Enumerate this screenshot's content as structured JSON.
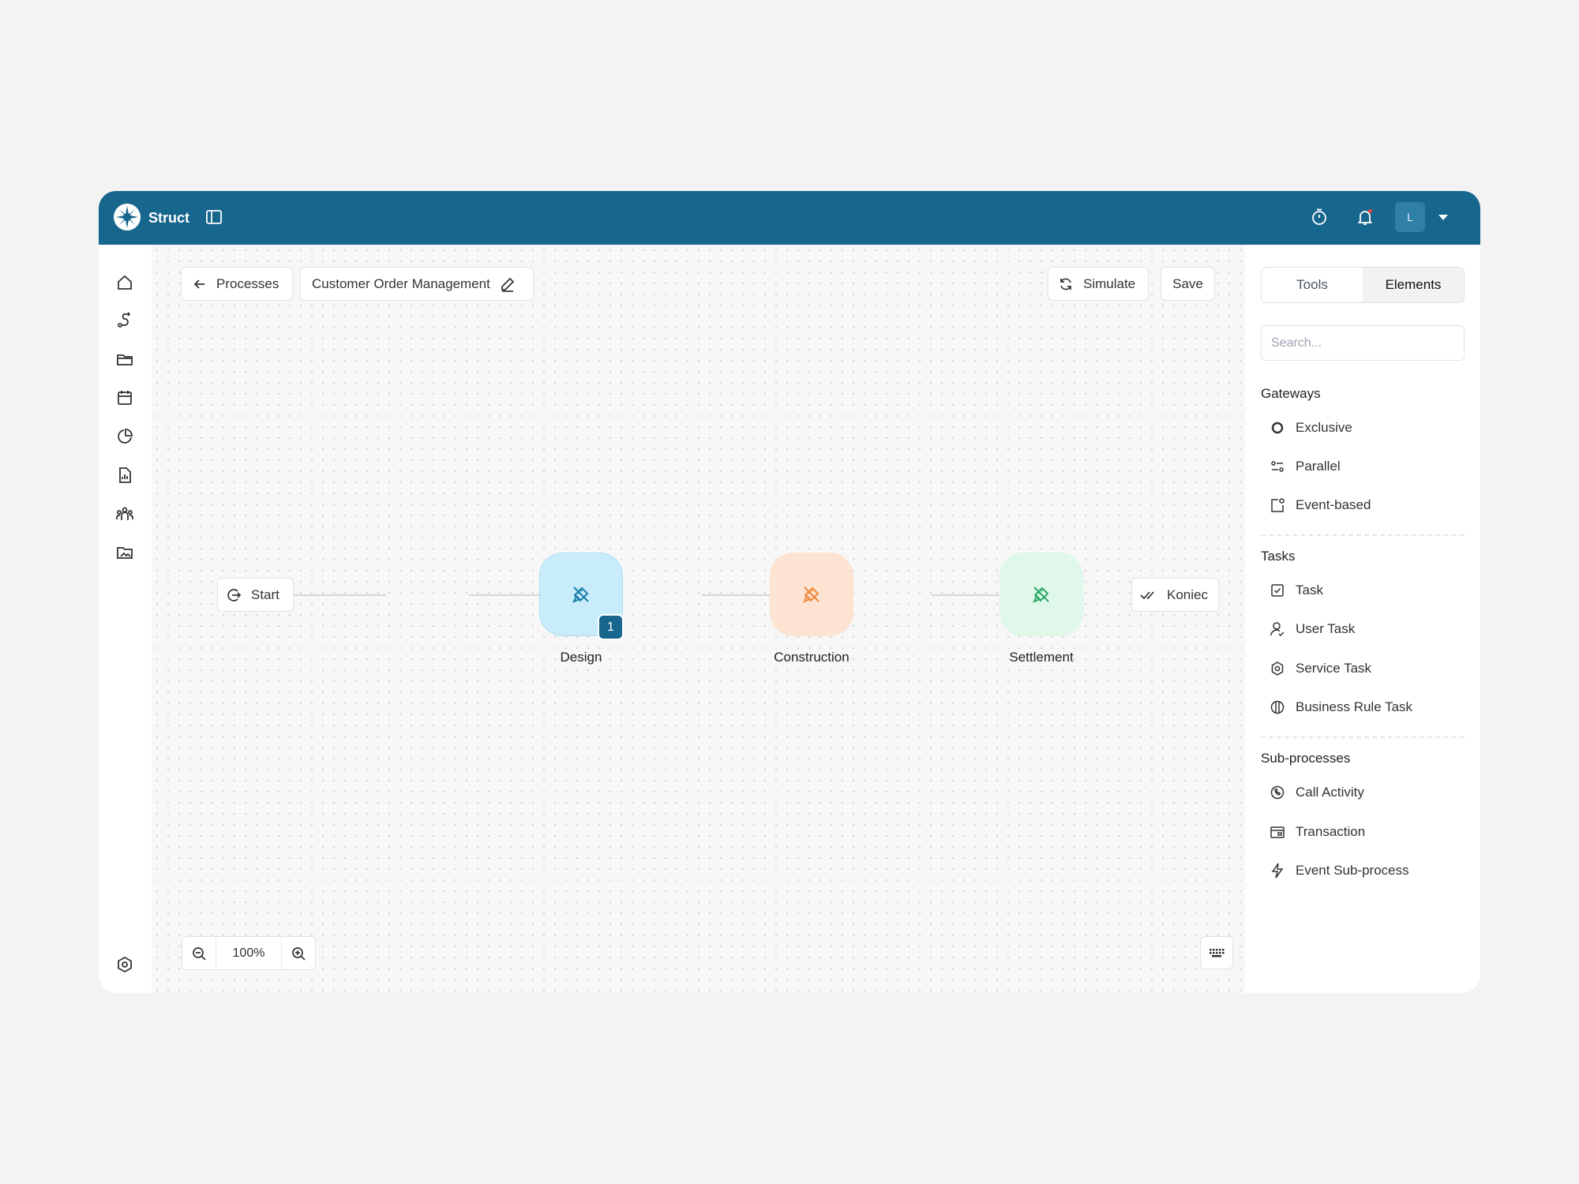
{
  "app": {
    "brand": "Struct",
    "avatar_initial": "L"
  },
  "topbar": {
    "icons": [
      "panel-toggle-icon",
      "timer-icon",
      "bell-icon",
      "caret-down-icon"
    ]
  },
  "sidenav": {
    "items": [
      "home-icon",
      "route-icon",
      "folder-icon",
      "calendar-icon",
      "pie-chart-icon",
      "report-icon",
      "team-icon",
      "image-folder-icon"
    ],
    "bottom": "settings-icon"
  },
  "toolbar": {
    "back_label": "Processes",
    "process_name": "Customer Order Management",
    "simulate_label": "Simulate",
    "save_label": "Save"
  },
  "flow": {
    "start_label": "Start",
    "end_label": "Koniec",
    "nodes": [
      {
        "label": "Design",
        "color": "#c9ecfb",
        "accent": "#1a7fa8",
        "badge": "1"
      },
      {
        "label": "Construction",
        "color": "#fde3d1",
        "accent": "#f08a3c"
      },
      {
        "label": "Settlement",
        "color": "#dff8ea",
        "accent": "#2ea86a"
      }
    ]
  },
  "zoom": {
    "value": "100%"
  },
  "panel": {
    "tabs": [
      "Tools",
      "Elements"
    ],
    "active_tab": "Elements",
    "search_placeholder": "Search...",
    "sections": [
      {
        "title": "Gateways",
        "items": [
          {
            "label": "Exclusive",
            "icon": "circle-icon"
          },
          {
            "label": "Parallel",
            "icon": "parallel-icon"
          },
          {
            "label": "Event-based",
            "icon": "event-based-icon"
          }
        ]
      },
      {
        "title": "Tasks",
        "items": [
          {
            "label": "Task",
            "icon": "checkbox-icon"
          },
          {
            "label": "User Task",
            "icon": "user-icon"
          },
          {
            "label": "Service Task",
            "icon": "gear-icon"
          },
          {
            "label": "Business Rule Task",
            "icon": "rule-icon"
          }
        ]
      },
      {
        "title": "Sub-processes",
        "items": [
          {
            "label": "Call Activity",
            "icon": "call-icon"
          },
          {
            "label": "Transaction",
            "icon": "transaction-icon"
          },
          {
            "label": "Event Sub-process",
            "icon": "lightning-icon"
          }
        ]
      }
    ]
  }
}
